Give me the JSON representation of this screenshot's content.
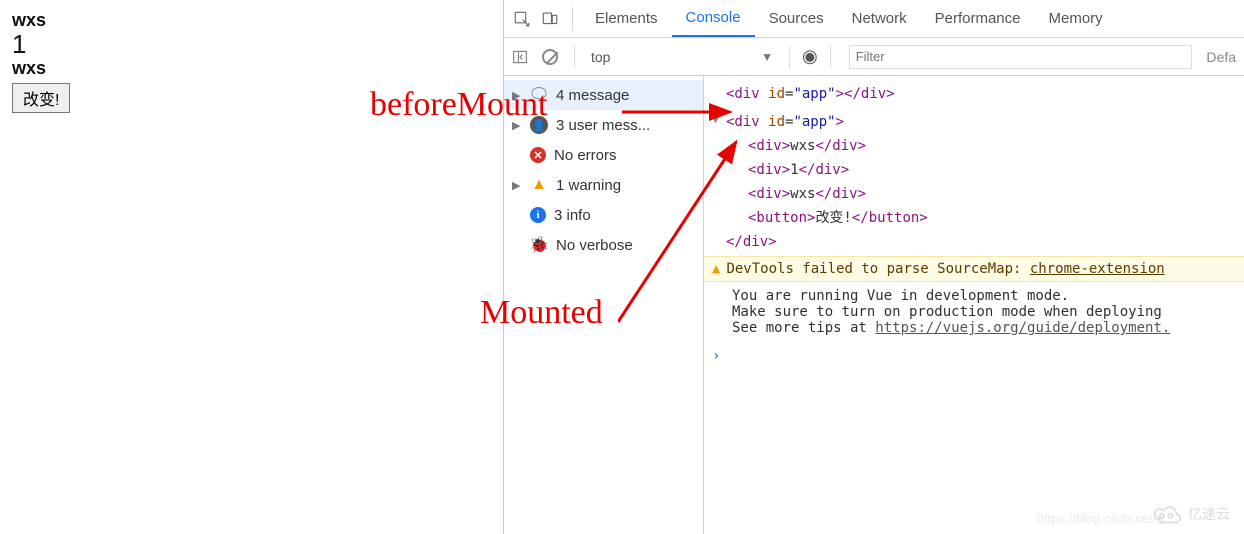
{
  "page": {
    "line1": "wxs",
    "line2": "1",
    "line3": "wxs",
    "button_label": "改变!"
  },
  "annotations": {
    "beforeMount": "beforeMount",
    "mounted": "Mounted"
  },
  "devtools": {
    "tabs": {
      "elements": "Elements",
      "console": "Console",
      "sources": "Sources",
      "network": "Network",
      "performance": "Performance",
      "memory": "Memory"
    },
    "subbar": {
      "context": "top",
      "filter_placeholder": "Filter",
      "default_levels": "Defa"
    },
    "sidebar": {
      "messages": "4 message",
      "user_messages": "3 user mess...",
      "no_errors": "No errors",
      "warnings": "1 warning",
      "info": "3 info",
      "verbose": "No verbose"
    },
    "console": {
      "log1": {
        "open": "<div id=\"app\"></div>",
        "tag": "div",
        "attr": "id",
        "val": "app"
      },
      "tree": {
        "root_open": "<div id=\"app\">",
        "c1_open": "<div>",
        "c1_txt": "wxs",
        "c1_close": "</div>",
        "c2_open": "<div>",
        "c2_txt": "1",
        "c2_close": "</div>",
        "c3_open": "<div>",
        "c3_txt": "wxs",
        "c3_close": "</div>",
        "btn_open": "<button>",
        "btn_txt": "改变!",
        "btn_close": "</button>",
        "root_close": "</div>"
      },
      "warning_prefix": "DevTools failed to parse SourceMap: ",
      "warning_link": "chrome-extension",
      "info_l1": "You are running Vue in development mode.",
      "info_l2": "Make sure to turn on production mode when deploying ",
      "info_l3_pre": "See more tips at ",
      "info_l3_link": "https://vuejs.org/guide/deployment."
    }
  },
  "watermark": {
    "blog": "https://blog.csdn.net/q",
    "brand": "亿速云"
  }
}
